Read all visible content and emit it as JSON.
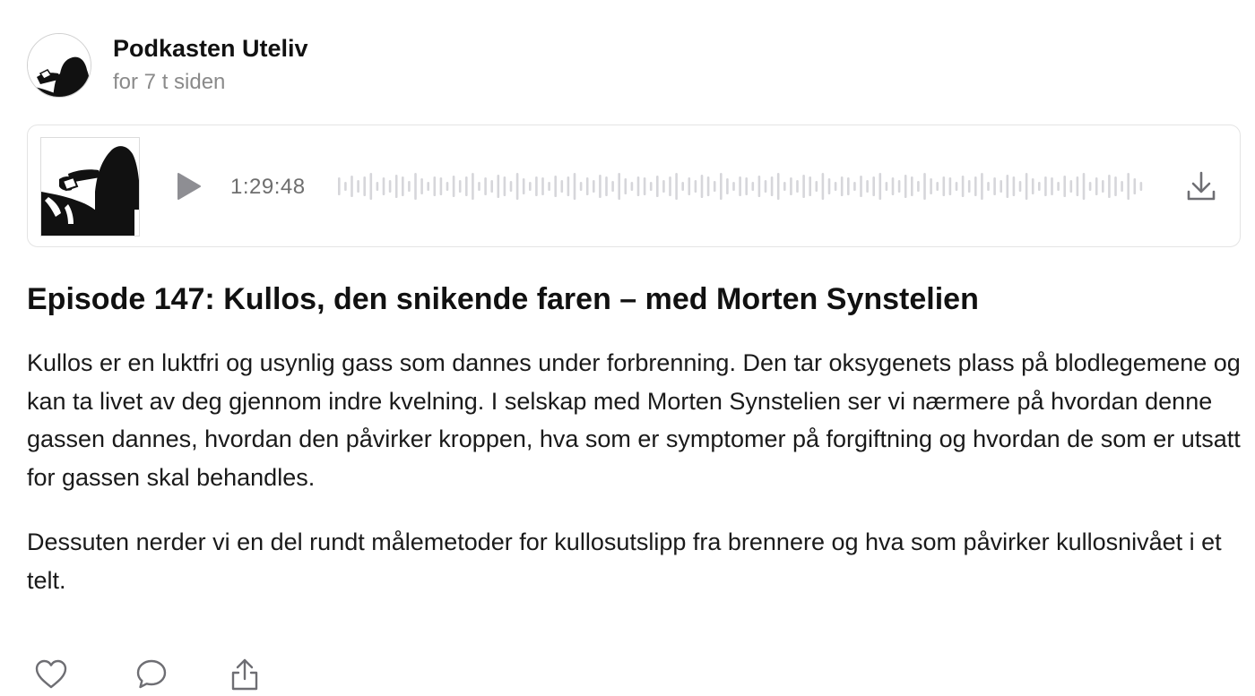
{
  "post": {
    "author": "Podkasten Uteliv",
    "time": "for 7 t siden",
    "avatar_icon": "podcast-avatar-silhouette"
  },
  "player": {
    "duration": "1:29:48",
    "play_icon": "play-icon",
    "download_icon": "download-icon",
    "cover_icon": "podcast-cover-art",
    "waveform_color": "#d6d6da",
    "play_color": "#8e8e93"
  },
  "episode": {
    "title": "Episode 147: Kullos, den snikende faren – med Morten Synstelien",
    "paragraphs": [
      "Kullos er en luktfri og usynlig gass som dannes under forbrenning. Den tar oksygenets plass på blodlegemene og kan ta livet av deg gjennom indre kvelning. I selskap med Morten Synstelien ser vi nærmere på hvordan denne gassen dannes, hvordan den påvirker kroppen, hva som er symptomer på forgiftning og hvordan de som er utsatt for gassen skal behandles.",
      "Dessuten nerder vi en del rundt målemetoder for kullosutslipp fra brennere og hva som påvirker kullosnivået i et telt."
    ]
  },
  "actions": {
    "like_icon": "heart-icon",
    "comment_icon": "comment-icon",
    "share_icon": "share-icon"
  }
}
